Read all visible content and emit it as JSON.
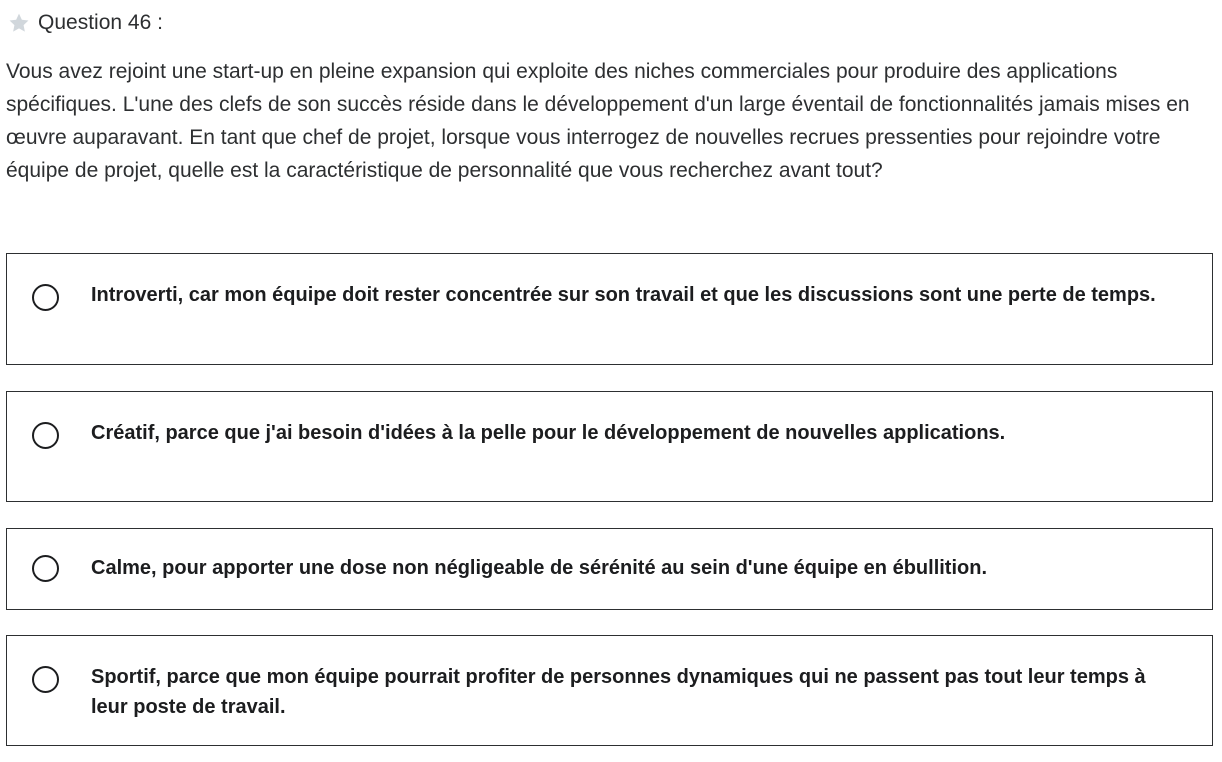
{
  "question": {
    "star_icon": "star-icon",
    "star_color": "#d1d7dc",
    "label": "Question 46 :",
    "text": "Vous avez rejoint une start-up en pleine expansion qui exploite des niches commerciales pour produire des applications spécifiques. L'une des clefs de son succès réside dans le développement d'un large éventail de fonctionnalités jamais mises en œuvre auparavant. En tant que chef de projet, lorsque vous interrogez de nouvelles recrues pressenties pour rejoindre votre équipe de projet, quelle est la caractéristique de personnalité que vous recherchez avant tout?"
  },
  "answers": [
    {
      "label": "Introverti, car mon équipe doit rester concentrée sur son travail et que les discussions sont une perte de temps.",
      "selected": false
    },
    {
      "label": "Créatif, parce que j'ai besoin d'idées à la pelle pour le développement de nouvelles applications.",
      "selected": false
    },
    {
      "label": "Calme, pour apporter une dose non négligeable de sérénité au sein d'une équipe en ébullition.",
      "selected": false
    },
    {
      "label": "Sportif, parce que mon équipe pourrait profiter de personnes dynamiques qui ne passent pas tout leur temps à leur poste de travail.",
      "selected": false
    }
  ],
  "colors": {
    "text": "#2d2f31",
    "border": "#2d2f31"
  }
}
